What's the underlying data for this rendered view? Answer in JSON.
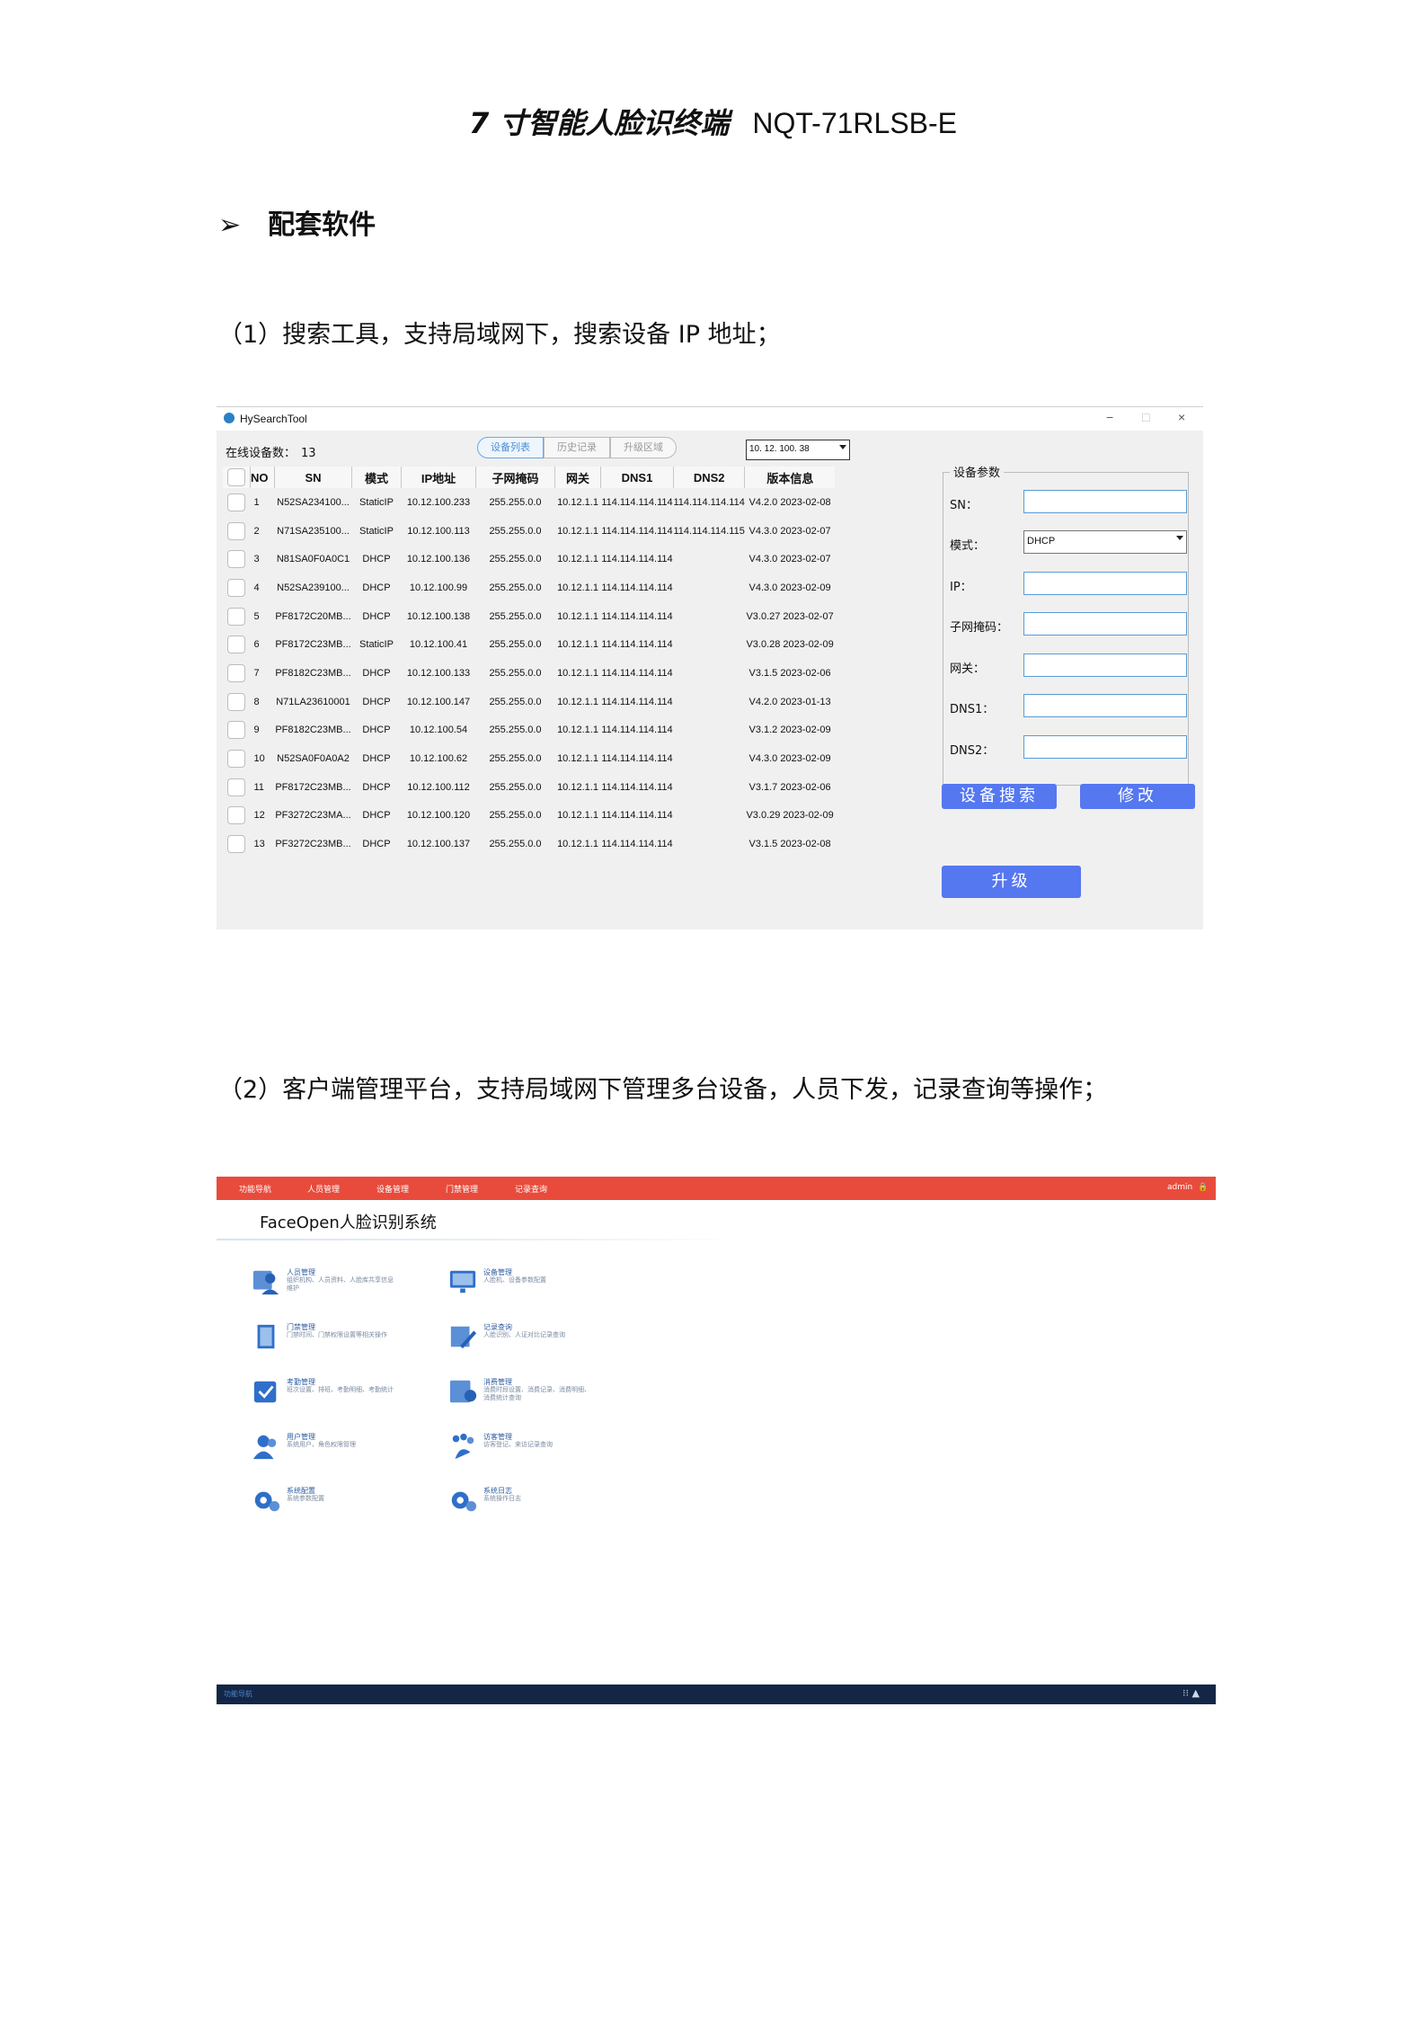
{
  "header": {
    "title_cn": "7 寸智能人脸识终端",
    "title_model": "NQT-71RLSB-E",
    "section_arrow": "➢",
    "section_title": "配套软件",
    "para1": "（1）搜索工具，支持局域网下，搜索设备 IP 地址；",
    "para2": "（2）客户端管理平台，支持局域网下管理多台设备，人员下发，记录查询等操作；"
  },
  "search_tool": {
    "app_name": "HySearchTool",
    "window_controls": [
      "−",
      "□",
      "×"
    ],
    "online_count_label": "在线设备数：",
    "online_count": "13",
    "tabs": [
      "设备列表",
      "历史记录",
      "升级区域"
    ],
    "active_tab": "设备列表",
    "ip_select": "10. 12. 100. 38",
    "columns": [
      "NO",
      "SN",
      "模式",
      "IP地址",
      "子网掩码",
      "网关",
      "DNS1",
      "DNS2",
      "版本信息"
    ],
    "rows": [
      {
        "no": "1",
        "sn": "N52SA234100...",
        "mode": "StaticIP",
        "ip": "10.12.100.233",
        "mask": "255.255.0.0",
        "gw": "10.12.1.1",
        "dns1": "114.114.114.114",
        "dns2": "114.114.114.114",
        "ver": "V4.2.0 2023-02-08"
      },
      {
        "no": "2",
        "sn": "N71SA235100...",
        "mode": "StaticIP",
        "ip": "10.12.100.113",
        "mask": "255.255.0.0",
        "gw": "10.12.1.1",
        "dns1": "114.114.114.114",
        "dns2": "114.114.114.115",
        "ver": "V4.3.0 2023-02-07"
      },
      {
        "no": "3",
        "sn": "N81SA0F0A0C1",
        "mode": "DHCP",
        "ip": "10.12.100.136",
        "mask": "255.255.0.0",
        "gw": "10.12.1.1",
        "dns1": "114.114.114.114",
        "dns2": "",
        "ver": "V4.3.0 2023-02-07"
      },
      {
        "no": "4",
        "sn": "N52SA239100...",
        "mode": "DHCP",
        "ip": "10.12.100.99",
        "mask": "255.255.0.0",
        "gw": "10.12.1.1",
        "dns1": "114.114.114.114",
        "dns2": "",
        "ver": "V4.3.0 2023-02-09"
      },
      {
        "no": "5",
        "sn": "PF8172C20MB...",
        "mode": "DHCP",
        "ip": "10.12.100.138",
        "mask": "255.255.0.0",
        "gw": "10.12.1.1",
        "dns1": "114.114.114.114",
        "dns2": "",
        "ver": "V3.0.27 2023-02-07"
      },
      {
        "no": "6",
        "sn": "PF8172C23MB...",
        "mode": "StaticIP",
        "ip": "10.12.100.41",
        "mask": "255.255.0.0",
        "gw": "10.12.1.1",
        "dns1": "114.114.114.114",
        "dns2": "",
        "ver": "V3.0.28 2023-02-09"
      },
      {
        "no": "7",
        "sn": "PF8182C23MB...",
        "mode": "DHCP",
        "ip": "10.12.100.133",
        "mask": "255.255.0.0",
        "gw": "10.12.1.1",
        "dns1": "114.114.114.114",
        "dns2": "",
        "ver": "V3.1.5 2023-02-06"
      },
      {
        "no": "8",
        "sn": "N71LA23610001",
        "mode": "DHCP",
        "ip": "10.12.100.147",
        "mask": "255.255.0.0",
        "gw": "10.12.1.1",
        "dns1": "114.114.114.114",
        "dns2": "",
        "ver": "V4.2.0 2023-01-13"
      },
      {
        "no": "9",
        "sn": "PF8182C23MB...",
        "mode": "DHCP",
        "ip": "10.12.100.54",
        "mask": "255.255.0.0",
        "gw": "10.12.1.1",
        "dns1": "114.114.114.114",
        "dns2": "",
        "ver": "V3.1.2 2023-02-09"
      },
      {
        "no": "10",
        "sn": "N52SA0F0A0A2",
        "mode": "DHCP",
        "ip": "10.12.100.62",
        "mask": "255.255.0.0",
        "gw": "10.12.1.1",
        "dns1": "114.114.114.114",
        "dns2": "",
        "ver": "V4.3.0 2023-02-09"
      },
      {
        "no": "11",
        "sn": "PF8172C23MB...",
        "mode": "DHCP",
        "ip": "10.12.100.112",
        "mask": "255.255.0.0",
        "gw": "10.12.1.1",
        "dns1": "114.114.114.114",
        "dns2": "",
        "ver": "V3.1.7 2023-02-06"
      },
      {
        "no": "12",
        "sn": "PF3272C23MA...",
        "mode": "DHCP",
        "ip": "10.12.100.120",
        "mask": "255.255.0.0",
        "gw": "10.12.1.1",
        "dns1": "114.114.114.114",
        "dns2": "",
        "ver": "V3.0.29 2023-02-09"
      },
      {
        "no": "13",
        "sn": "PF3272C23MB...",
        "mode": "DHCP",
        "ip": "10.12.100.137",
        "mask": "255.255.0.0",
        "gw": "10.12.1.1",
        "dns1": "114.114.114.114",
        "dns2": "",
        "ver": "V3.1.5 2023-02-08"
      }
    ],
    "params_title": "设备参数",
    "params": {
      "sn_label": "SN：",
      "mode_label": "模式：",
      "mode_value": "DHCP",
      "ip_label": "IP：",
      "mask_label": "子网掩码：",
      "gw_label": "网关：",
      "dns1_label": "DNS1：",
      "dns2_label": "DNS2："
    },
    "search_button": "设备搜索",
    "modify_button": "修改",
    "upgrade_button": "升级",
    "button_color": "#5577f0"
  },
  "platform": {
    "nav": [
      "功能导航",
      "人员管理",
      "设备管理",
      "门禁管理",
      "记录查询"
    ],
    "user": "admin",
    "lock_icon": "lock-icon",
    "system_name": "FaceOpen人脸识别系统",
    "nav_color": "#e84b3c",
    "modules": [
      {
        "title": "人员管理",
        "desc": "组织机构、人员资料、人脸库共享信息维护",
        "icon": "person-card-icon"
      },
      {
        "title": "设备管理",
        "desc": "人脸机、设备参数配置",
        "icon": "monitor-icon"
      },
      {
        "title": "门禁管理",
        "desc": "门禁时间、门禁权限设置等相关操作",
        "icon": "door-icon"
      },
      {
        "title": "记录查询",
        "desc": "人脸识别、人证对比记录查询",
        "icon": "edit-record-icon"
      },
      {
        "title": "考勤管理",
        "desc": "班次设置、排班、考勤明细、考勤统计",
        "icon": "checkbox-icon"
      },
      {
        "title": "消费管理",
        "desc": "消费时段设置、消费记录、消费明细、消费统计查询",
        "icon": "consume-icon"
      },
      {
        "title": "用户管理",
        "desc": "系统用户、角色权限管理",
        "icon": "users-icon"
      },
      {
        "title": "访客管理",
        "desc": "访客登记、来访记录查询",
        "icon": "visitor-icon"
      },
      {
        "title": "系统配置",
        "desc": "系统参数配置",
        "icon": "gear-icon"
      },
      {
        "title": "系统日志",
        "desc": "系统操作日志",
        "icon": "log-gear-icon"
      }
    ],
    "bottom_left": "功能导航",
    "bottom_right": "⁝⁝ ▲"
  }
}
